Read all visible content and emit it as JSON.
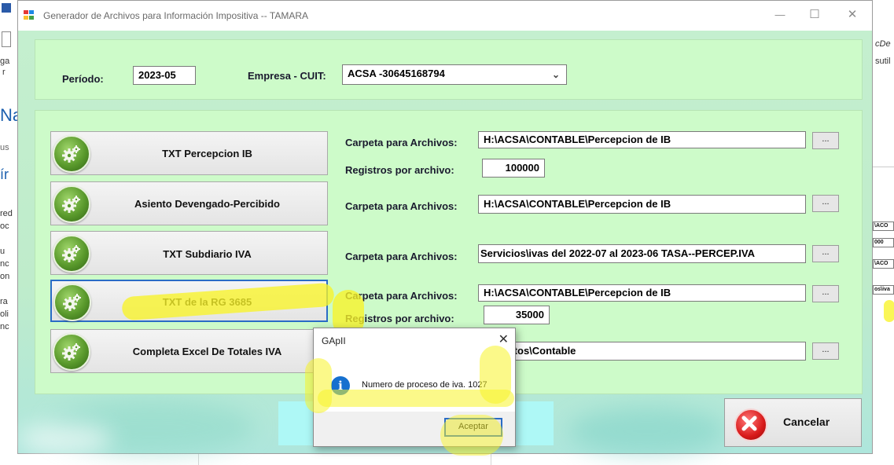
{
  "window": {
    "title": "Generador de Archivos para Información Impositiva  --  TAMARA",
    "minimize": "—",
    "maximize": "☐",
    "close": "✕"
  },
  "header": {
    "periodo_label": "Período:",
    "periodo_value": "2023-05",
    "empresa_label": "Empresa - CUIT:",
    "empresa_value": "ACSA  -30645168794"
  },
  "actions": [
    {
      "label": "TXT Percepcion IB",
      "folder_label": "Carpeta para Archivos:",
      "folder_value": "H:\\ACSA\\CONTABLE\\Percepcion de IB",
      "registros_label": "Registros por archivo:",
      "registros_value": "100000"
    },
    {
      "label": "Asiento Devengado-Percibido",
      "folder_label": "Carpeta para Archivos:",
      "folder_value": "H:\\ACSA\\CONTABLE\\Percepcion de IB"
    },
    {
      "label": "TXT Subdiario IVA",
      "folder_label": "Carpeta para Archivos:",
      "folder_value": "Servicios\\ivas del 2022-07 al 2023-06    TASA--PERCEP.IVA"
    },
    {
      "label": "TXT de la RG 3685",
      "folder_label": "Carpeta para Archivos:",
      "folder_value": "H:\\ACSA\\CONTABLE\\Percepcion de IB",
      "registros_label": "Registros por archivo:",
      "registros_value": "35000"
    },
    {
      "label": "Completa Excel De Totales IVA",
      "folder_value": "ral\\datos\\Contable"
    }
  ],
  "browse_label": "...",
  "cancel_label": "Cancelar",
  "dialog": {
    "title": "GApII",
    "close": "✕",
    "message": "Numero de proceso de iva. 1027",
    "ok_label": "Aceptar"
  },
  "background_app": {
    "left_fragments": [
      "ga",
      "r",
      "Na",
      "us",
      "ír",
      "red",
      "oc",
      "u",
      "nc",
      "on",
      "ra",
      "oli",
      "nc"
    ],
    "right_fragments": [
      "cDe",
      "sutil"
    ],
    "right_cells": [
      "\\ACO",
      "000",
      "\\ACO",
      "os\\iva"
    ]
  },
  "colors": {
    "form_background": "#c4efcf",
    "panel": "#cdfbc9",
    "highlighter": "#f8f428",
    "focus": "#2a6cc6"
  },
  "icons": [
    "gear-icon",
    "cancel-icon",
    "info-icon",
    "app-icon"
  ]
}
